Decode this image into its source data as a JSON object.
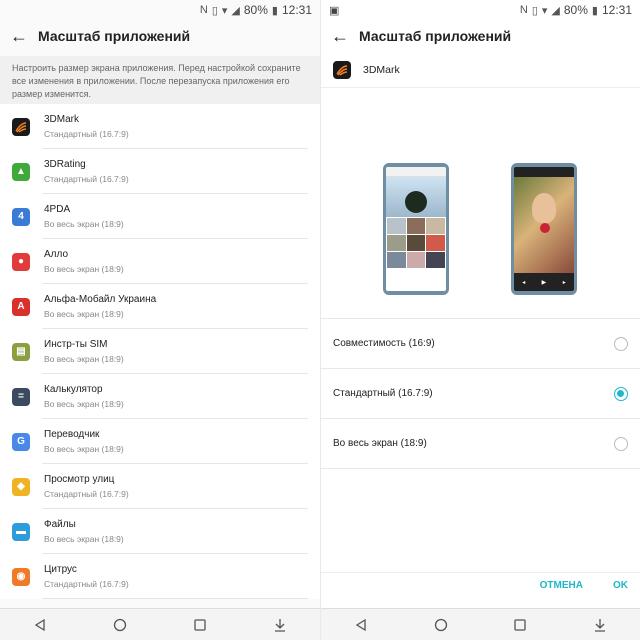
{
  "status": {
    "time": "12:31",
    "battery": "80%"
  },
  "left": {
    "title": "Масштаб приложений",
    "description": "Настроить размер экрана приложения. Перед настройкой сохраните все изменения в приложении. После перезапуска приложения его размер изменится.",
    "apps": [
      {
        "name": "3DMark",
        "mode": "Стандартный (16.7:9)",
        "icon": "3dmark-icon",
        "color": "#1a1a1a"
      },
      {
        "name": "3DRating",
        "mode": "Стандартный (16.7:9)",
        "icon": "3drating-icon",
        "color": "#3faa3a"
      },
      {
        "name": "4PDA",
        "mode": "Во весь экран (18:9)",
        "icon": "4pda-icon",
        "color": "#3a7bd5"
      },
      {
        "name": "Алло",
        "mode": "Во весь экран (18:9)",
        "icon": "allo-icon",
        "color": "#e23b3b"
      },
      {
        "name": "Альфа-Мобайл Украина",
        "mode": "Во весь экран (18:9)",
        "icon": "alfa-icon",
        "color": "#d9302c"
      },
      {
        "name": "Инстр-ты SIM",
        "mode": "Во весь экран (18:9)",
        "icon": "sim-icon",
        "color": "#8aa040"
      },
      {
        "name": "Калькулятор",
        "mode": "Во весь экран (18:9)",
        "icon": "calculator-icon",
        "color": "#3b4a60"
      },
      {
        "name": "Переводчик",
        "mode": "Во весь экран (18:9)",
        "icon": "translate-icon",
        "color": "#4a88e8"
      },
      {
        "name": "Просмотр улиц",
        "mode": "Стандартный (16.7:9)",
        "icon": "streetview-icon",
        "color": "#f0b323"
      },
      {
        "name": "Файлы",
        "mode": "Во весь экран (18:9)",
        "icon": "files-icon",
        "color": "#2d9cdb"
      },
      {
        "name": "Цитрус",
        "mode": "Стандартный (16.7:9)",
        "icon": "citrus-icon",
        "color": "#f07a2a"
      }
    ]
  },
  "right": {
    "title": "Масштаб приложений",
    "app_name": "3DMark",
    "options": [
      {
        "label": "Совместимость (16:9)",
        "selected": false
      },
      {
        "label": "Стандартный (16.7:9)",
        "selected": true
      },
      {
        "label": "Во весь экран (18:9)",
        "selected": false
      }
    ],
    "cancel": "ОТМЕНА",
    "ok": "OK"
  },
  "colors": {
    "accent": "#1db8c9",
    "phone_frame": "#6e8fa3"
  }
}
